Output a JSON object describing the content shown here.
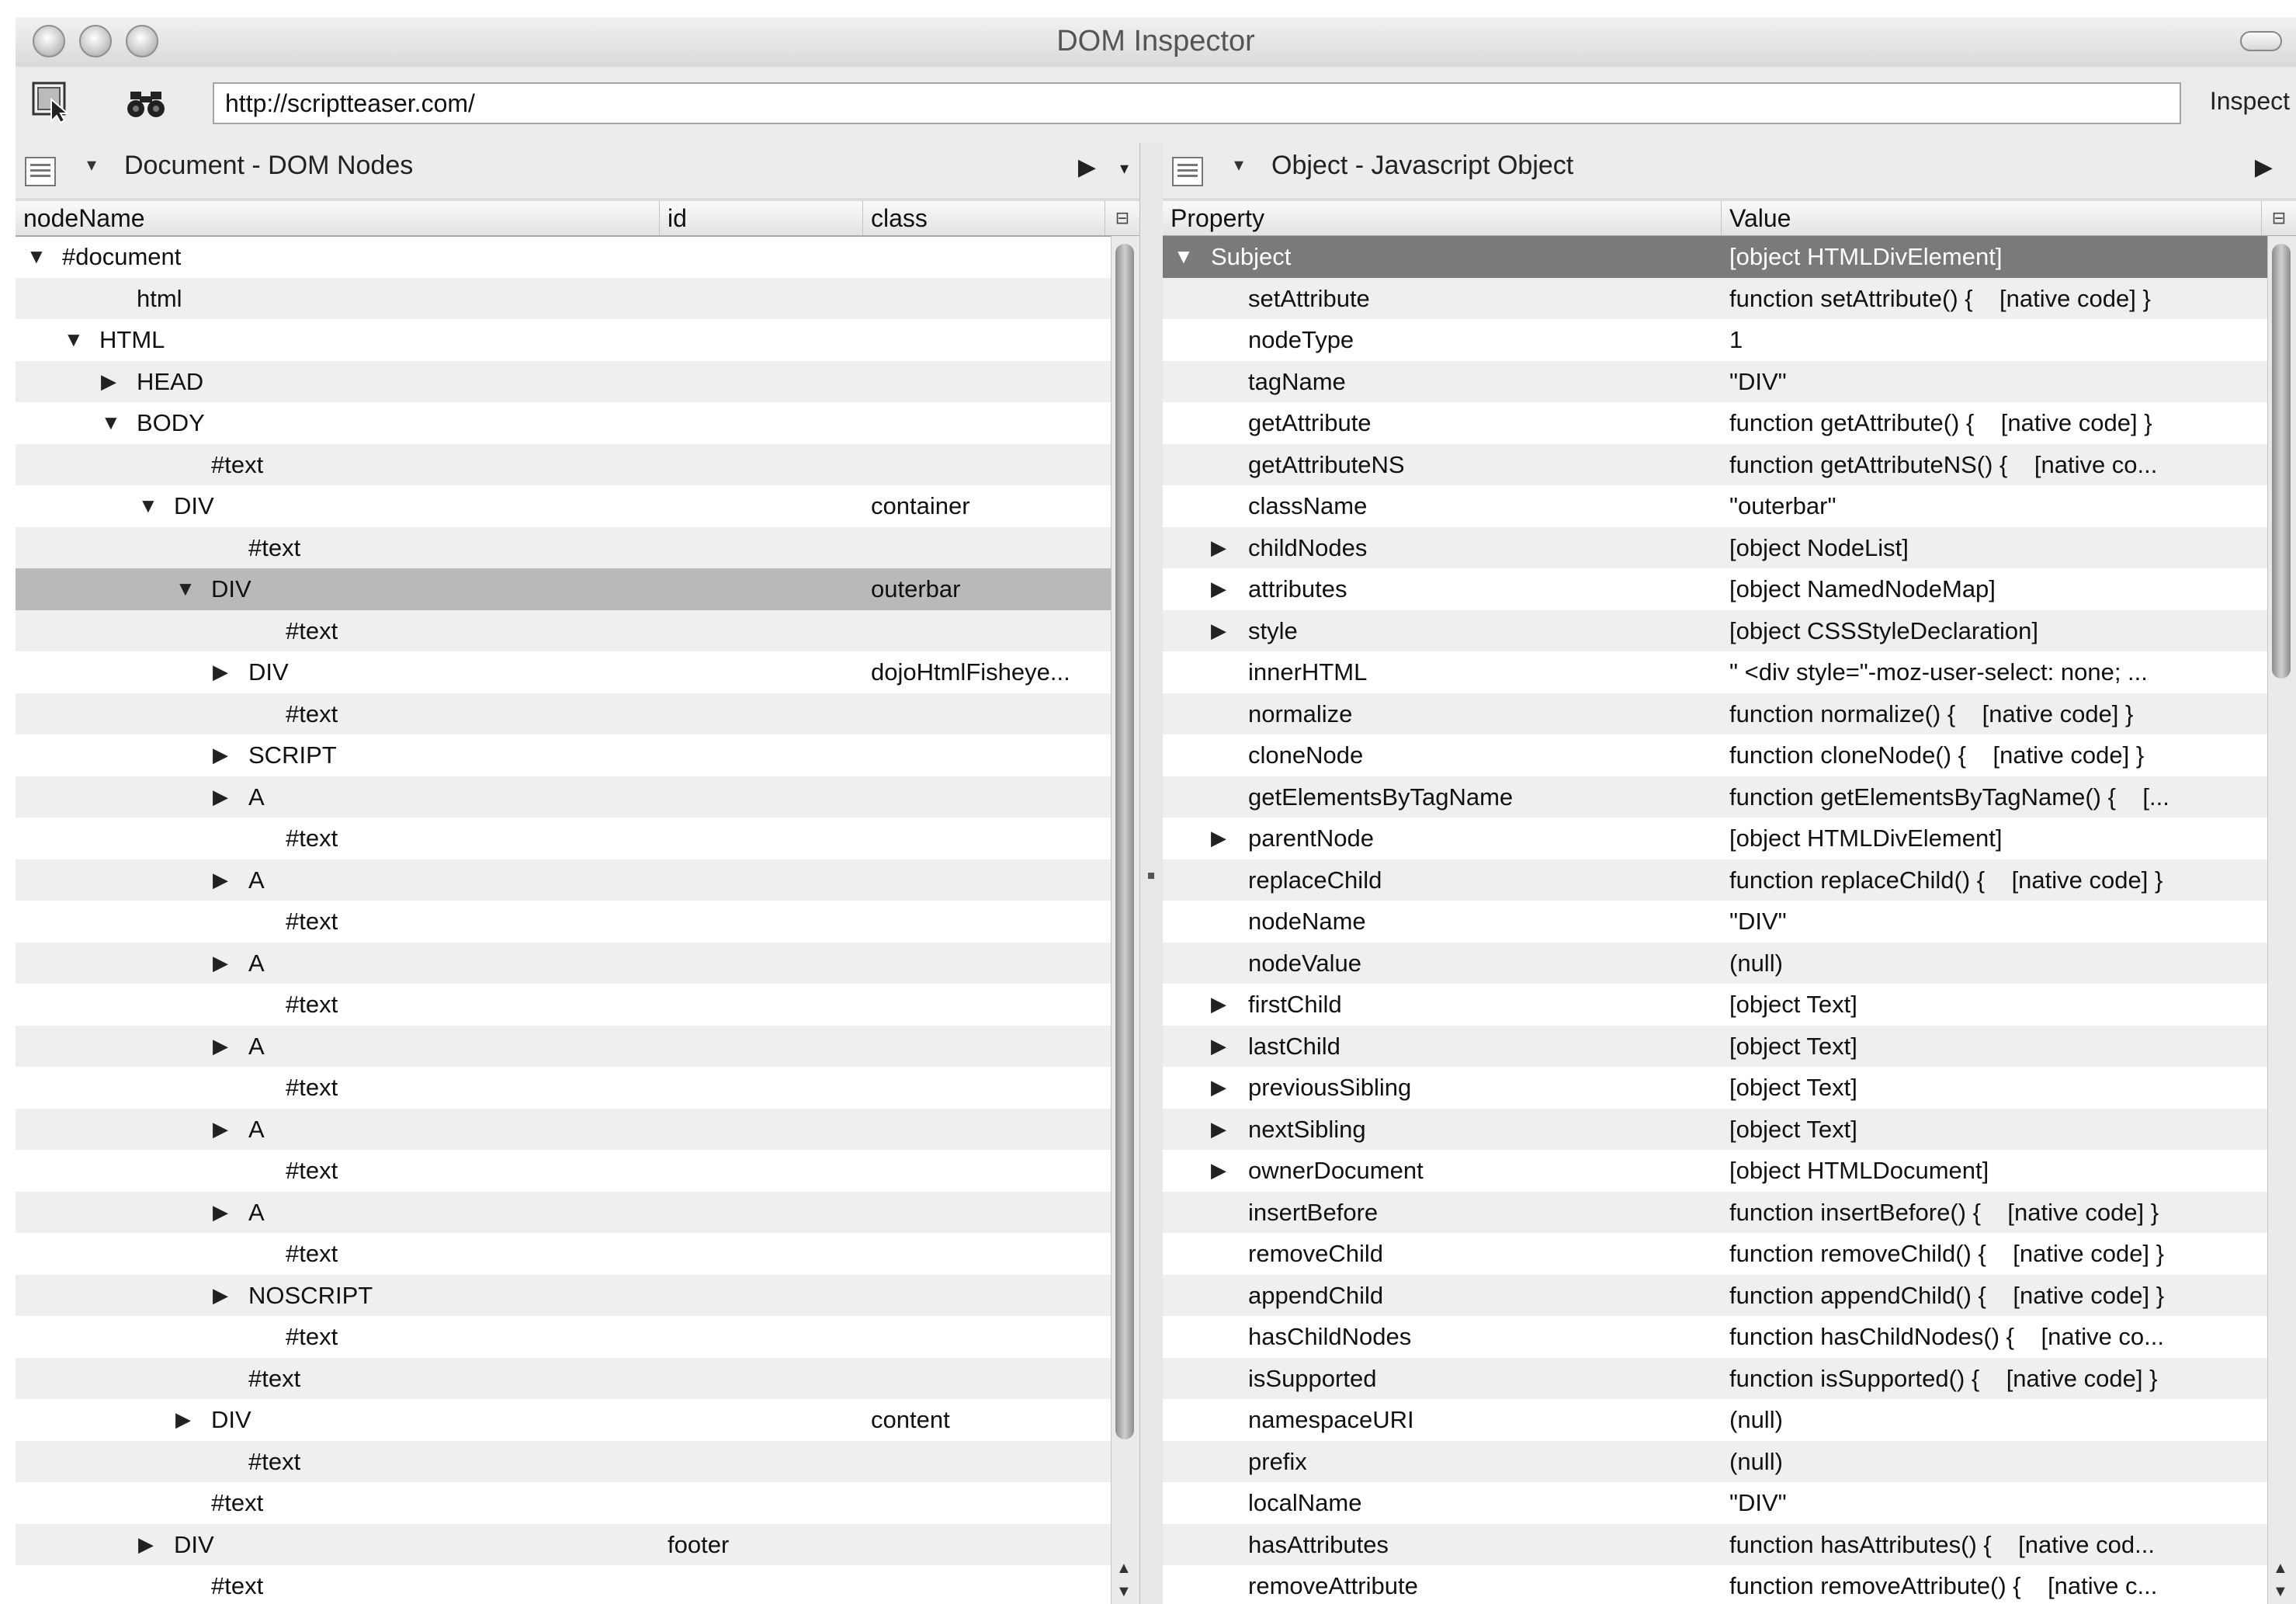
{
  "window": {
    "title": "DOM Inspector"
  },
  "toolbar": {
    "url": "http://scriptteaser.com/",
    "inspect_label": "Inspect"
  },
  "left_panel": {
    "title": "Document - DOM Nodes",
    "columns": [
      "nodeName",
      "id",
      "class"
    ],
    "rows": [
      {
        "name": "#document",
        "id": "",
        "cls": "",
        "level": 0,
        "twisty": "open"
      },
      {
        "name": "html",
        "id": "",
        "cls": "",
        "level": 2,
        "twisty": ""
      },
      {
        "name": "HTML",
        "id": "",
        "cls": "",
        "level": 1,
        "twisty": "open"
      },
      {
        "name": "HEAD",
        "id": "",
        "cls": "",
        "level": 2,
        "twisty": "closed"
      },
      {
        "name": "BODY",
        "id": "",
        "cls": "",
        "level": 2,
        "twisty": "open"
      },
      {
        "name": "#text",
        "id": "",
        "cls": "",
        "level": 4,
        "twisty": ""
      },
      {
        "name": "DIV",
        "id": "",
        "cls": "container",
        "level": 3,
        "twisty": "open"
      },
      {
        "name": "#text",
        "id": "",
        "cls": "",
        "level": 5,
        "twisty": ""
      },
      {
        "name": "DIV",
        "id": "",
        "cls": "outerbar",
        "level": 4,
        "twisty": "open",
        "selected": true
      },
      {
        "name": "#text",
        "id": "",
        "cls": "",
        "level": 6,
        "twisty": ""
      },
      {
        "name": "DIV",
        "id": "",
        "cls": "dojoHtmlFisheye...",
        "level": 5,
        "twisty": "closed"
      },
      {
        "name": "#text",
        "id": "",
        "cls": "",
        "level": 6,
        "twisty": ""
      },
      {
        "name": "SCRIPT",
        "id": "",
        "cls": "",
        "level": 5,
        "twisty": "closed"
      },
      {
        "name": "A",
        "id": "",
        "cls": "",
        "level": 5,
        "twisty": "closed"
      },
      {
        "name": "#text",
        "id": "",
        "cls": "",
        "level": 6,
        "twisty": ""
      },
      {
        "name": "A",
        "id": "",
        "cls": "",
        "level": 5,
        "twisty": "closed"
      },
      {
        "name": "#text",
        "id": "",
        "cls": "",
        "level": 6,
        "twisty": ""
      },
      {
        "name": "A",
        "id": "",
        "cls": "",
        "level": 5,
        "twisty": "closed"
      },
      {
        "name": "#text",
        "id": "",
        "cls": "",
        "level": 6,
        "twisty": ""
      },
      {
        "name": "A",
        "id": "",
        "cls": "",
        "level": 5,
        "twisty": "closed"
      },
      {
        "name": "#text",
        "id": "",
        "cls": "",
        "level": 6,
        "twisty": ""
      },
      {
        "name": "A",
        "id": "",
        "cls": "",
        "level": 5,
        "twisty": "closed"
      },
      {
        "name": "#text",
        "id": "",
        "cls": "",
        "level": 6,
        "twisty": ""
      },
      {
        "name": "A",
        "id": "",
        "cls": "",
        "level": 5,
        "twisty": "closed"
      },
      {
        "name": "#text",
        "id": "",
        "cls": "",
        "level": 6,
        "twisty": ""
      },
      {
        "name": "NOSCRIPT",
        "id": "",
        "cls": "",
        "level": 5,
        "twisty": "closed"
      },
      {
        "name": "#text",
        "id": "",
        "cls": "",
        "level": 6,
        "twisty": ""
      },
      {
        "name": "#text",
        "id": "",
        "cls": "",
        "level": 5,
        "twisty": ""
      },
      {
        "name": "DIV",
        "id": "",
        "cls": "content",
        "level": 4,
        "twisty": "closed"
      },
      {
        "name": "#text",
        "id": "",
        "cls": "",
        "level": 5,
        "twisty": ""
      },
      {
        "name": "#text",
        "id": "",
        "cls": "",
        "level": 4,
        "twisty": ""
      },
      {
        "name": "DIV",
        "id": "footer",
        "cls": "",
        "level": 3,
        "twisty": "closed"
      },
      {
        "name": "#text",
        "id": "",
        "cls": "",
        "level": 4,
        "twisty": ""
      }
    ]
  },
  "right_panel": {
    "title": "Object - Javascript Object",
    "columns": [
      "Property",
      "Value"
    ],
    "rows": [
      {
        "prop": "Subject",
        "value": "[object HTMLDivElement]",
        "twisty": "open",
        "subject": true
      },
      {
        "prop": "setAttribute",
        "value": "function setAttribute() {    [native code] }",
        "twisty": ""
      },
      {
        "prop": "nodeType",
        "value": "1",
        "twisty": ""
      },
      {
        "prop": "tagName",
        "value": "\"DIV\"",
        "twisty": ""
      },
      {
        "prop": "getAttribute",
        "value": "function getAttribute() {    [native code] }",
        "twisty": ""
      },
      {
        "prop": "getAttributeNS",
        "value": "function getAttributeNS() {    [native co...",
        "twisty": ""
      },
      {
        "prop": "className",
        "value": "\"outerbar\"",
        "twisty": ""
      },
      {
        "prop": "childNodes",
        "value": "[object NodeList]",
        "twisty": "closed"
      },
      {
        "prop": "attributes",
        "value": "[object NamedNodeMap]",
        "twisty": "closed"
      },
      {
        "prop": "style",
        "value": "[object CSSStyleDeclaration]",
        "twisty": "closed"
      },
      {
        "prop": "innerHTML",
        "value": "\" <div style=\"-moz-user-select: none; ...",
        "twisty": ""
      },
      {
        "prop": "normalize",
        "value": "function normalize() {    [native code] }",
        "twisty": ""
      },
      {
        "prop": "cloneNode",
        "value": "function cloneNode() {    [native code] }",
        "twisty": ""
      },
      {
        "prop": "getElementsByTagName",
        "value": "function getElementsByTagName() {    [...",
        "twisty": ""
      },
      {
        "prop": "parentNode",
        "value": "[object HTMLDivElement]",
        "twisty": "closed"
      },
      {
        "prop": "replaceChild",
        "value": "function replaceChild() {    [native code] }",
        "twisty": ""
      },
      {
        "prop": "nodeName",
        "value": "\"DIV\"",
        "twisty": ""
      },
      {
        "prop": "nodeValue",
        "value": "(null)",
        "twisty": ""
      },
      {
        "prop": "firstChild",
        "value": "[object Text]",
        "twisty": "closed"
      },
      {
        "prop": "lastChild",
        "value": "[object Text]",
        "twisty": "closed"
      },
      {
        "prop": "previousSibling",
        "value": "[object Text]",
        "twisty": "closed"
      },
      {
        "prop": "nextSibling",
        "value": "[object Text]",
        "twisty": "closed"
      },
      {
        "prop": "ownerDocument",
        "value": "[object HTMLDocument]",
        "twisty": "closed"
      },
      {
        "prop": "insertBefore",
        "value": "function insertBefore() {    [native code] }",
        "twisty": ""
      },
      {
        "prop": "removeChild",
        "value": "function removeChild() {    [native code] }",
        "twisty": ""
      },
      {
        "prop": "appendChild",
        "value": "function appendChild() {    [native code] }",
        "twisty": ""
      },
      {
        "prop": "hasChildNodes",
        "value": "function hasChildNodes() {    [native co...",
        "twisty": ""
      },
      {
        "prop": "isSupported",
        "value": "function isSupported() {    [native code] }",
        "twisty": ""
      },
      {
        "prop": "namespaceURI",
        "value": "(null)",
        "twisty": ""
      },
      {
        "prop": "prefix",
        "value": "(null)",
        "twisty": ""
      },
      {
        "prop": "localName",
        "value": "\"DIV\"",
        "twisty": ""
      },
      {
        "prop": "hasAttributes",
        "value": "function hasAttributes() {    [native cod...",
        "twisty": ""
      },
      {
        "prop": "removeAttribute",
        "value": "function removeAttribute() {    [native c...",
        "twisty": ""
      }
    ]
  }
}
